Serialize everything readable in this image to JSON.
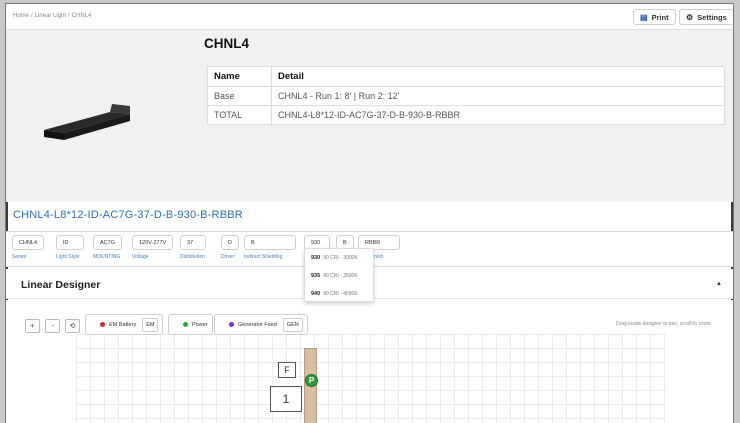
{
  "breadcrumb": [
    "Home",
    "/",
    "Linear Light",
    "/",
    "CHNL4"
  ],
  "toolbar": {
    "print_label": "Print",
    "settings_label": "Settings",
    "print_icon": "printer-icon",
    "settings_icon": "gear-icon"
  },
  "product": {
    "title": "CHNL4",
    "table": {
      "headers": [
        "Name",
        "Detail"
      ],
      "rows": [
        [
          "Base",
          "CHNL4 - Run 1: 8' | Run 2: 12'"
        ],
        [
          "TOTAL",
          "CHNL4-L8*12-ID-AC7G-37-D-B-930-B-RBBR"
        ]
      ]
    }
  },
  "config_string": "CHNL4-L8*12-ID-AC7G-37-D-B-930-B-RBBR",
  "options": [
    {
      "value": "CHNL4",
      "label": "Series"
    },
    {
      "value": "ID",
      "label": "Light Style"
    },
    {
      "value": "AC7G",
      "label": "MOUNTING"
    },
    {
      "value": "120V-277V",
      "label": "Voltage"
    },
    {
      "value": "37",
      "label": "Distribution"
    },
    {
      "value": "D",
      "label": "Driver"
    },
    {
      "value": "B",
      "label": "Indirect Shielding"
    },
    {
      "value": "930",
      "label": ""
    },
    {
      "value": "B",
      "label": ""
    },
    {
      "value": "RBBR",
      "label": "lding Finish"
    }
  ],
  "cct_dropdown": [
    {
      "code": "930",
      "desc": "90 CRI - 3000K"
    },
    {
      "code": "935",
      "desc": "90 CRI - 3500K"
    },
    {
      "code": "940",
      "desc": "90 CRI - 4000K"
    }
  ],
  "designer": {
    "title": "Linear Designer",
    "controls": [
      "+",
      "-",
      "⟲"
    ],
    "legend": [
      {
        "label": "EM Battery",
        "tag": "EM",
        "color": "#d62b2b"
      },
      {
        "label": "Power",
        "tag": "",
        "color": "#2fa83b"
      },
      {
        "label": "Generator Feed",
        "tag": "GEN",
        "color": "#7a2fd0"
      }
    ],
    "hint": "Drag inside designer to pan, scroll to zoom",
    "fixture": {
      "f_label": "F",
      "run_number": "1",
      "power_badge": "P"
    }
  }
}
